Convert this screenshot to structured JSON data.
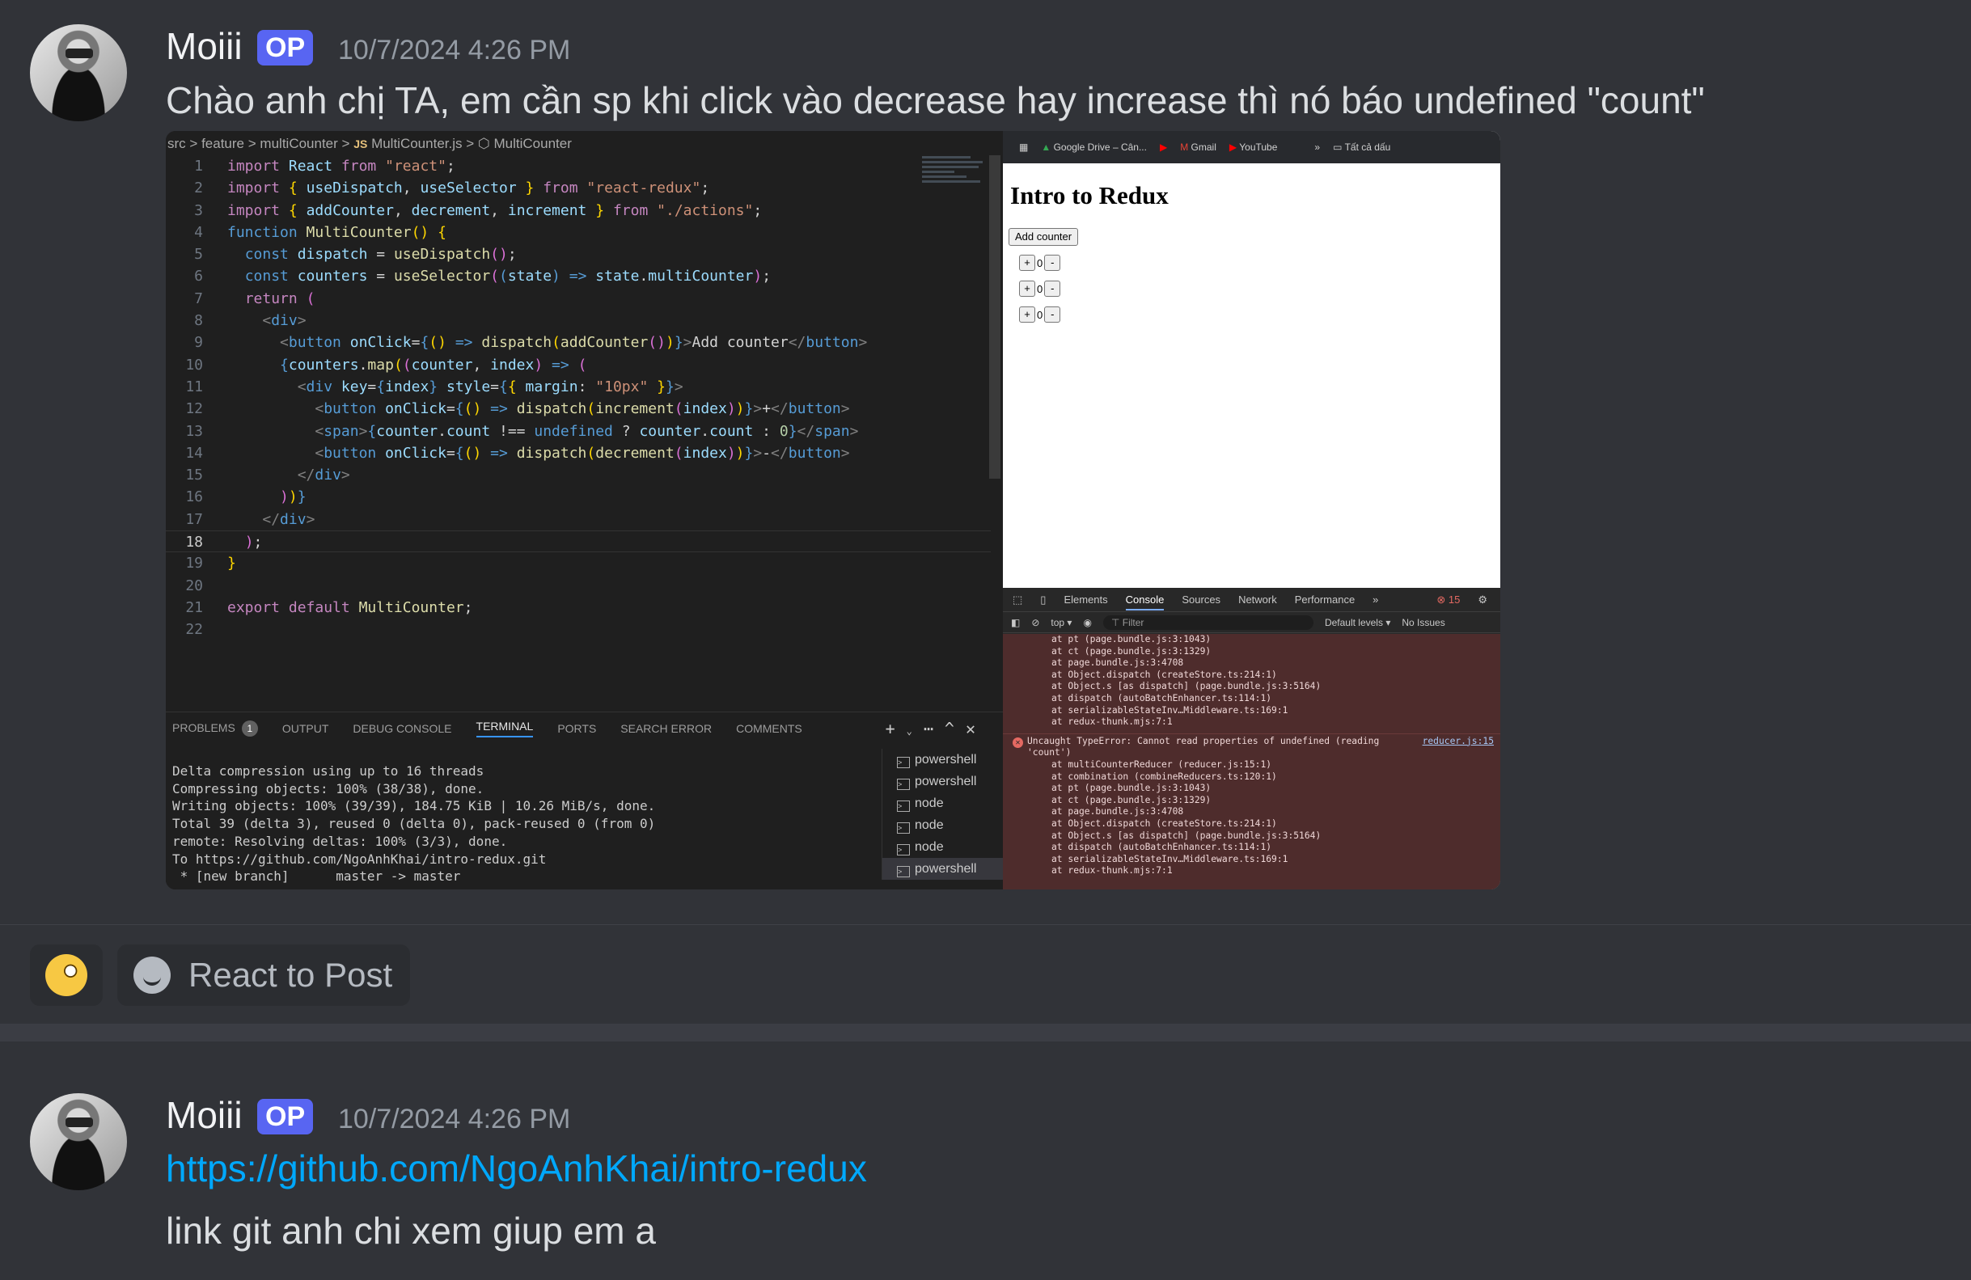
{
  "messages": [
    {
      "author": "Moiii",
      "badge": "OP",
      "timestamp": "10/7/2024 4:26 PM",
      "text": "Chào anh chị TA, em cần sp khi click vào decrease hay increase thì nó báo undefined \"count\""
    },
    {
      "author": "Moiii",
      "badge": "OP",
      "timestamp": "10/7/2024 4:26 PM",
      "link": "https://github.com/NgoAnhKhai/intro-redux",
      "text": "link git anh chi xem giup em a"
    }
  ],
  "reactions": {
    "emoji": "face-with-monocle",
    "react_label": "React to Post"
  },
  "editor": {
    "breadcrumb": [
      "src",
      ">",
      "feature",
      ">",
      "multiCounter",
      ">",
      "JS",
      "MultiCounter.js",
      ">",
      "MultiCounter"
    ],
    "current_line": 18,
    "line_numbers": [
      "1",
      "2",
      "3",
      "4",
      "5",
      "6",
      "7",
      "8",
      "9",
      "10",
      "11",
      "12",
      "13",
      "14",
      "15",
      "16",
      "17",
      "18",
      "19",
      "20",
      "21",
      "22"
    ]
  },
  "terminal": {
    "tabs": [
      "PROBLEMS",
      "OUTPUT",
      "DEBUG CONSOLE",
      "TERMINAL",
      "PORTS",
      "SEARCH ERROR",
      "COMMENTS"
    ],
    "problems_count": "1",
    "output": "Delta compression using up to 16 threads\nCompressing objects: 100% (38/38), done.\nWriting objects: 100% (39/39), 184.75 KiB | 10.26 MiB/s, done.\nTotal 39 (delta 3), reused 0 (delta 0), pack-reused 0 (from 0)\nremote: Resolving deltas: 100% (3/3), done.\nTo https://github.com/NgoAnhKhai/intro-redux.git\n * [new branch]      master -> master",
    "shells": [
      "powershell",
      "powershell",
      "node",
      "node",
      "node",
      "powershell"
    ]
  },
  "browser": {
    "bookmarks": [
      "Google Drive – Cân...",
      "Gmail",
      "YouTube",
      "Tất cả dấu"
    ],
    "page_title": "Intro to Redux",
    "add_button": "Add counter",
    "counters": [
      {
        "plus": "+",
        "value": "0",
        "minus": "-"
      },
      {
        "plus": "+",
        "value": "0",
        "minus": "-"
      },
      {
        "plus": "+",
        "value": "0",
        "minus": "-"
      }
    ],
    "devtools_tabs": [
      "Elements",
      "Console",
      "Sources",
      "Network",
      "Performance"
    ],
    "error_count": "15",
    "toolbar": {
      "context": "top",
      "filter": "Filter",
      "levels": "Default levels",
      "issues": "No Issues"
    },
    "console_stack1": [
      "at pt (page.bundle.js:3:1043)",
      "at ct (page.bundle.js:3:1329)",
      "at page.bundle.js:3:4708",
      "at Object.dispatch (createStore.ts:214:1)",
      "at Object.s [as dispatch] (page.bundle.js:3:5164)",
      "at dispatch (autoBatchEnhancer.ts:114:1)",
      "at serializableStateInv…Middleware.ts:169:1",
      "at redux-thunk.mjs:7:1"
    ],
    "error_message": "Uncaught TypeError: Cannot read properties of undefined (reading 'count')",
    "error_source": "reducer.js:15",
    "console_stack2": [
      "at multiCounterReducer (reducer.js:15:1)",
      "at combination (combineReducers.ts:120:1)",
      "at pt (page.bundle.js:3:1043)",
      "at ct (page.bundle.js:3:1329)",
      "at page.bundle.js:3:4708",
      "at Object.dispatch (createStore.ts:214:1)",
      "at Object.s [as dispatch] (page.bundle.js:3:5164)",
      "at dispatch (autoBatchEnhancer.ts:114:1)",
      "at serializableStateInv…Middleware.ts:169:1",
      "at redux-thunk.mjs:7:1"
    ]
  }
}
